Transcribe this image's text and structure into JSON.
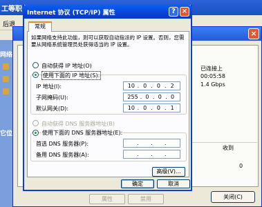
{
  "background_window": {
    "title": "工等职",
    "back_label": "后退",
    "left_labels": [
      "网络",
      "它位"
    ]
  },
  "status_dialog": {
    "status": "已连接上",
    "duration": "00:05:58",
    "speed": "1.4 Gbps",
    "received_header": "收到",
    "packets_received": "0",
    "properties_button": "属性",
    "disable_button": "禁用",
    "close_button": "关闭(C)"
  },
  "tcpip_dialog": {
    "title": "Internet 协议 (TCP/IP) 属性",
    "help_icon": "?",
    "close_icon": "×",
    "tab": "常规",
    "intro": "如果网络支持此功能，则可以获取自动指派的 IP 设置。否则，您需要从网络系统管理员处获得适当的 IP 设置。",
    "ip_section": {
      "auto_label": "自动获得 IP 地址(O)",
      "manual_label": "使用下面的 IP 地址(S):",
      "ip_label": "IP 地址(I):",
      "ip_value": [
        "10",
        "0",
        "0",
        "2"
      ],
      "mask_label": "子网掩码(U):",
      "mask_value": [
        "255",
        "0",
        "0",
        "0"
      ],
      "gateway_label": "默认网关(D):",
      "gateway_value": [
        "10",
        "0",
        "0",
        "1"
      ]
    },
    "dns_section": {
      "auto_label": "自动获得 DNS 服务器地址(B)",
      "manual_label": "使用下面的 DNS 服务器地址(E):",
      "preferred_label": "首选 DNS 服务器(P):",
      "alternate_label": "备用 DNS 服务器(A):"
    },
    "advanced_button": "高级(V)...",
    "ok_button": "确定",
    "cancel_button": "取消"
  }
}
